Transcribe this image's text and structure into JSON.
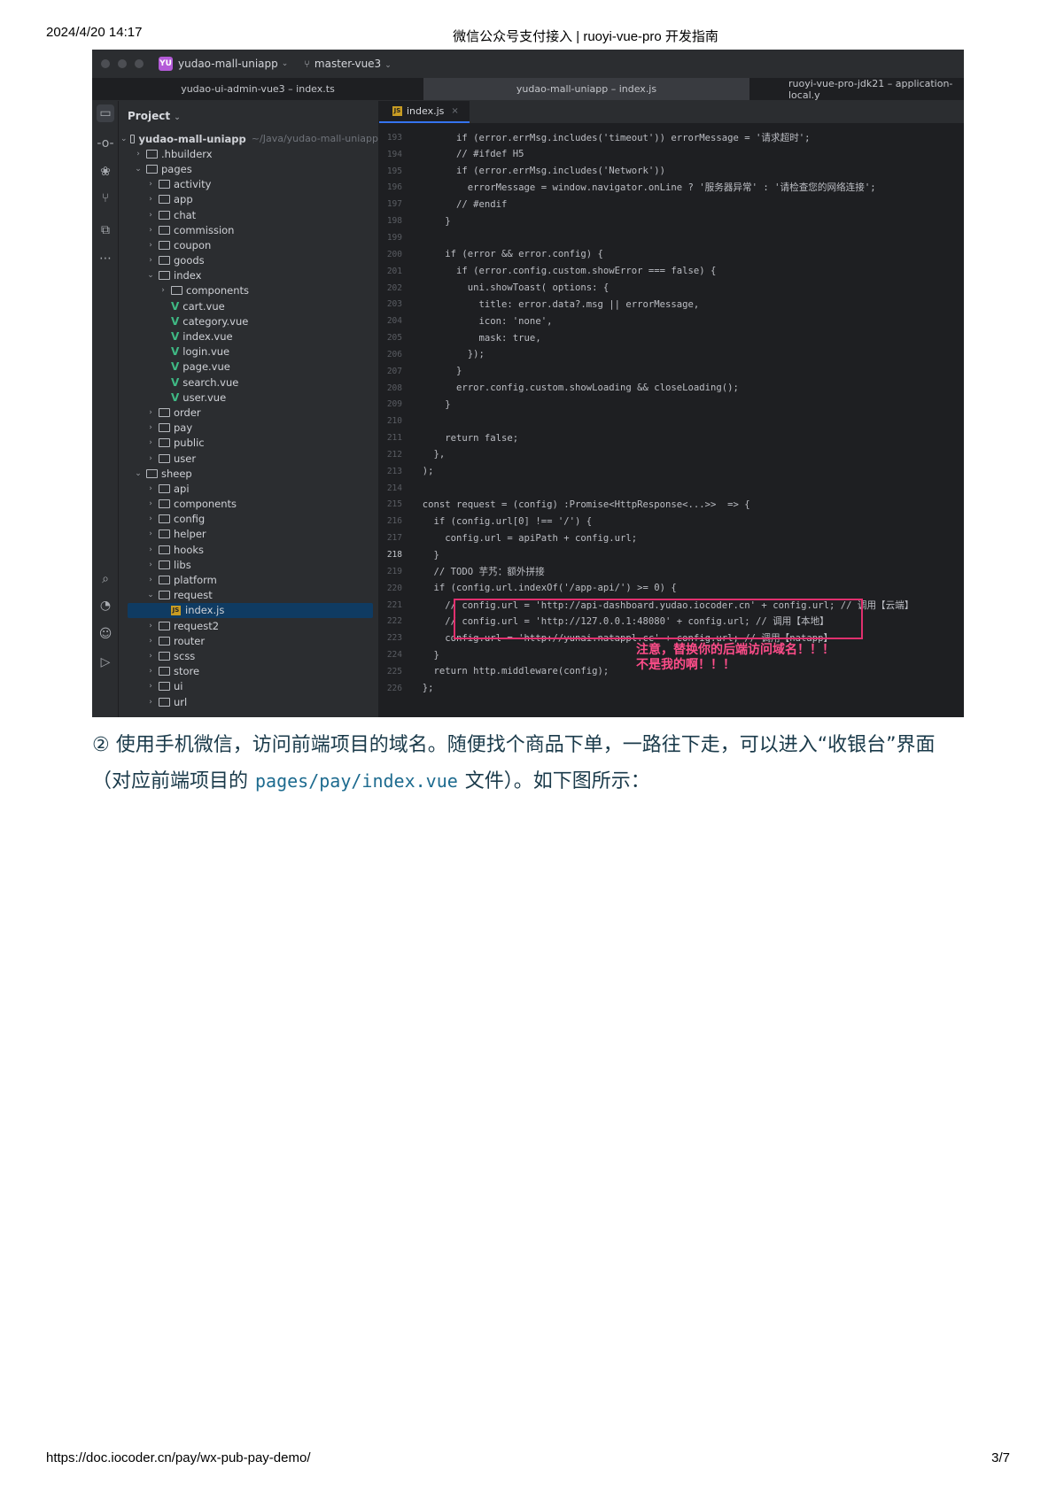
{
  "header": {
    "timestamp": "2024/4/20 14:17",
    "doc_title": "微信公众号支付接入 | ruoyi-vue-pro 开发指南"
  },
  "footer": {
    "url": "https://doc.iocoder.cn/pay/wx-pub-pay-demo/",
    "page": "3/7"
  },
  "ide": {
    "project_badge": "YU",
    "project_name": "yudao-mall-uniapp",
    "branch": "master-vue3",
    "window_tabs": [
      "yudao-ui-admin-vue3 – index.ts",
      "yudao-mall-uniapp – index.js",
      "ruoyi-vue-pro-jdk21 – application-local.y"
    ],
    "panel_title": "Project",
    "root_name": "yudao-mall-uniapp",
    "root_path": "~/Java/yudao-mall-uniapp",
    "editor_tab": "index.js",
    "tree": [
      {
        "name": ".hbuilderx",
        "kind": "folder",
        "depth": 1,
        "open": false
      },
      {
        "name": "pages",
        "kind": "folder",
        "depth": 1,
        "open": true
      },
      {
        "name": "activity",
        "kind": "folder",
        "depth": 2,
        "open": false
      },
      {
        "name": "app",
        "kind": "folder",
        "depth": 2,
        "open": false
      },
      {
        "name": "chat",
        "kind": "folder",
        "depth": 2,
        "open": false
      },
      {
        "name": "commission",
        "kind": "folder",
        "depth": 2,
        "open": false
      },
      {
        "name": "coupon",
        "kind": "folder",
        "depth": 2,
        "open": false
      },
      {
        "name": "goods",
        "kind": "folder",
        "depth": 2,
        "open": false
      },
      {
        "name": "index",
        "kind": "folder",
        "depth": 2,
        "open": true
      },
      {
        "name": "components",
        "kind": "folder",
        "depth": 3,
        "open": false
      },
      {
        "name": "cart.vue",
        "kind": "vue",
        "depth": 3
      },
      {
        "name": "category.vue",
        "kind": "vue",
        "depth": 3
      },
      {
        "name": "index.vue",
        "kind": "vue",
        "depth": 3
      },
      {
        "name": "login.vue",
        "kind": "vue",
        "depth": 3
      },
      {
        "name": "page.vue",
        "kind": "vue",
        "depth": 3
      },
      {
        "name": "search.vue",
        "kind": "vue",
        "depth": 3
      },
      {
        "name": "user.vue",
        "kind": "vue",
        "depth": 3
      },
      {
        "name": "order",
        "kind": "folder",
        "depth": 2,
        "open": false
      },
      {
        "name": "pay",
        "kind": "folder",
        "depth": 2,
        "open": false
      },
      {
        "name": "public",
        "kind": "folder",
        "depth": 2,
        "open": false
      },
      {
        "name": "user",
        "kind": "folder",
        "depth": 2,
        "open": false
      },
      {
        "name": "sheep",
        "kind": "folder",
        "depth": 1,
        "open": true
      },
      {
        "name": "api",
        "kind": "folder",
        "depth": 2,
        "open": false
      },
      {
        "name": "components",
        "kind": "folder",
        "depth": 2,
        "open": false
      },
      {
        "name": "config",
        "kind": "folder",
        "depth": 2,
        "open": false
      },
      {
        "name": "helper",
        "kind": "folder",
        "depth": 2,
        "open": false
      },
      {
        "name": "hooks",
        "kind": "folder",
        "depth": 2,
        "open": false
      },
      {
        "name": "libs",
        "kind": "folder",
        "depth": 2,
        "open": false
      },
      {
        "name": "platform",
        "kind": "folder",
        "depth": 2,
        "open": false
      },
      {
        "name": "request",
        "kind": "folder",
        "depth": 2,
        "open": true
      },
      {
        "name": "index.js",
        "kind": "js",
        "depth": 3,
        "selected": true
      },
      {
        "name": "request2",
        "kind": "folder",
        "depth": 2,
        "open": false
      },
      {
        "name": "router",
        "kind": "folder",
        "depth": 2,
        "open": false
      },
      {
        "name": "scss",
        "kind": "folder",
        "depth": 2,
        "open": false
      },
      {
        "name": "store",
        "kind": "folder",
        "depth": 2,
        "open": false
      },
      {
        "name": "ui",
        "kind": "folder",
        "depth": 2,
        "open": false
      },
      {
        "name": "url",
        "kind": "folder",
        "depth": 2,
        "open": false
      }
    ],
    "code": [
      {
        "n": "193",
        "t": "        if (error.errMsg.includes('timeout')) errorMessage = '请求超时';"
      },
      {
        "n": "194",
        "t": "        // #ifdef H5"
      },
      {
        "n": "195",
        "t": "        if (error.errMsg.includes('Network'))"
      },
      {
        "n": "196",
        "t": "          errorMessage = window.navigator.onLine ? '服务器异常' : '请检查您的网络连接';"
      },
      {
        "n": "197",
        "t": "        // #endif"
      },
      {
        "n": "198",
        "t": "      }"
      },
      {
        "n": "199",
        "t": ""
      },
      {
        "n": "200",
        "t": "      if (error && error.config) {"
      },
      {
        "n": "201",
        "t": "        if (error.config.custom.showError === false) {"
      },
      {
        "n": "202",
        "t": "          uni.showToast( options: {"
      },
      {
        "n": "203",
        "t": "            title: error.data?.msg || errorMessage,"
      },
      {
        "n": "204",
        "t": "            icon: 'none',"
      },
      {
        "n": "205",
        "t": "            mask: true,"
      },
      {
        "n": "206",
        "t": "          });"
      },
      {
        "n": "207",
        "t": "        }"
      },
      {
        "n": "208",
        "t": "        error.config.custom.showLoading && closeLoading();"
      },
      {
        "n": "209",
        "t": "      }"
      },
      {
        "n": "210",
        "t": ""
      },
      {
        "n": "211",
        "t": "      return false;"
      },
      {
        "n": "212",
        "t": "    },"
      },
      {
        "n": "213",
        "t": "  );"
      },
      {
        "n": "214",
        "t": ""
      },
      {
        "n": "215",
        "t": "  const request = (config) :Promise<HttpResponse<...>>  => {"
      },
      {
        "n": "216",
        "t": "    if (config.url[0] !== '/') {"
      },
      {
        "n": "217",
        "t": "      config.url = apiPath + config.url;"
      },
      {
        "n": "218",
        "t": "    }",
        "current": true
      },
      {
        "n": "219",
        "t": "    // TODO 芋艿：额外拼接"
      },
      {
        "n": "220",
        "t": "    if (config.url.indexOf('/app-api/') >= 0) {"
      },
      {
        "n": "221",
        "t": "      // config.url = 'http://api-dashboard.yudao.iocoder.cn' + config.url; // 调用【云端】"
      },
      {
        "n": "222",
        "t": "      // config.url = 'http://127.0.0.1:48080' + config.url; // 调用【本地】"
      },
      {
        "n": "223",
        "t": "      config.url = 'http://yunai.natappl.cc' + config.url; // 调用【natapp】"
      },
      {
        "n": "224",
        "t": "    }"
      },
      {
        "n": "225",
        "t": "    return http.middleware(config);"
      },
      {
        "n": "226",
        "t": "  };"
      }
    ],
    "annotation": "注意，替换你的后端访问域名！！！\n不是我的啊！！！"
  },
  "paragraph": {
    "part1": "② 使用手机微信，访问前端项目的域名。随便找个商品下单，一路往下走，可以进入“收银台”界面（对应前端项目的",
    "code": "pages/pay/index.vue",
    "part2": "文件）。如下图所示："
  },
  "colors": {
    "ide_bg": "#1e1f22",
    "panel_bg": "#2b2d30",
    "highlight_box": "#e0306e",
    "annotation": "#ff4d8a",
    "paragraph_text": "#1a3a4a",
    "inline_code": "#1d6b8f"
  }
}
